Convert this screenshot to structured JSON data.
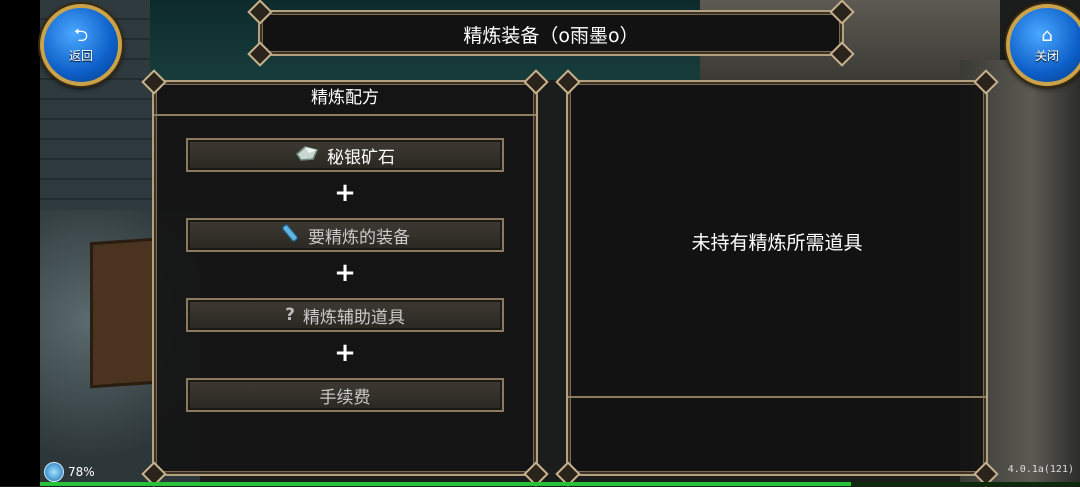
{
  "header": {
    "title": "精炼装备（o雨墨o）"
  },
  "nav": {
    "back_label": "返回",
    "close_label": "关闭"
  },
  "recipe": {
    "title": "精炼配方",
    "plus": "+",
    "slots": [
      {
        "icon": "silver-ore-icon",
        "label": "秘银矿石"
      },
      {
        "icon": "equipment-icon",
        "label": "要精炼的装备"
      },
      {
        "icon": "question-icon",
        "glyph": "?",
        "label": "精炼辅助道具"
      },
      {
        "label": "手续费"
      }
    ]
  },
  "info": {
    "message": "未持有精炼所需道具"
  },
  "status": {
    "battery": "78%",
    "version": "4.0.1a(121)",
    "progress": 0.78
  }
}
